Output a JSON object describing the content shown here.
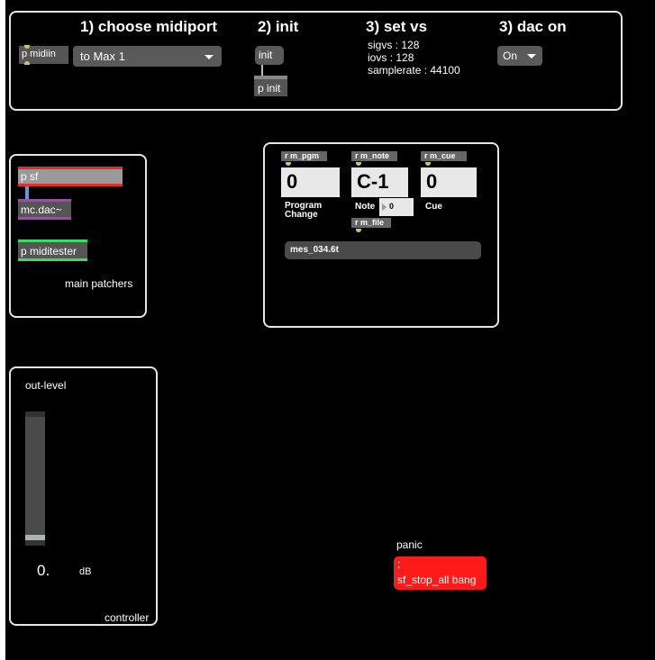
{
  "top_panel": {
    "step1_title": "1) choose midiport",
    "step2_title": "2) init",
    "step3_title": "3) set vs",
    "step4_title": "3) dac on",
    "midiin_object": "p midiin",
    "midiport_menu": "to Max 1",
    "init_button": "init",
    "init_object": "p init",
    "vs_info": [
      "sigvs : 128",
      "iovs : 128",
      "samplerate : 44100"
    ],
    "dac_menu": "On"
  },
  "main_patchers": {
    "label": "main patchers",
    "objects": [
      "p sf",
      "mc.dac~",
      "p miditester"
    ],
    "colors": {
      "sf": "#e0302c",
      "dac": "#b03cc8",
      "miditester": "#3cdc64"
    }
  },
  "receivers": {
    "pgm_receive": "r m_pgm",
    "note_receive": "r m_note",
    "cue_receive": "r m_cue",
    "file_receive": "r m_file",
    "program_value": "0",
    "program_label": "Program\nChange",
    "note_value": "C-1",
    "note_label": "Note",
    "note_sub_value": "0",
    "cue_value": "0",
    "cue_label": "Cue",
    "file_message": "mes_034.6t"
  },
  "controller": {
    "out_level_label": "out-level",
    "level_value": "0.",
    "unit": "dB",
    "label": "controller",
    "slider_level": 0.06
  },
  "panic": {
    "label": "panic",
    "message_line1": ";",
    "message_line2": "sf_stop_all bang",
    "color": "#ff1a1a"
  }
}
